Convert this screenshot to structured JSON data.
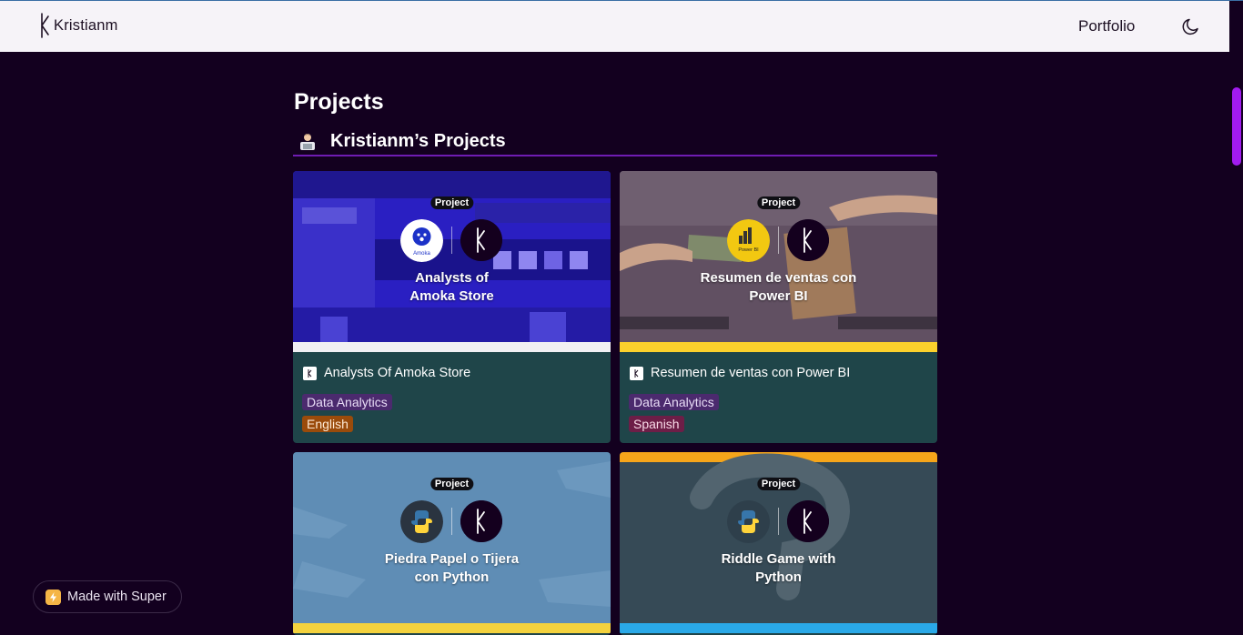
{
  "header": {
    "brand": "Kristianm",
    "nav_link": "Portfolio",
    "theme_toggle_icon": "moon-icon"
  },
  "page": {
    "title": "Projects",
    "section_emoji_icon": "technologist-emoji-icon",
    "section_title": "Kristianm’s Projects"
  },
  "cards": [
    {
      "badge": "Project",
      "cover_title_line1": "Analysts of",
      "cover_title_line2": "Amoka Store",
      "logo_text": "Amoka",
      "title": "Analysts Of Amoka Store",
      "tags": [
        "Data Analytics",
        "English"
      ]
    },
    {
      "badge": "Project",
      "cover_title_line1": "Resumen de ventas con",
      "cover_title_line2": "Power BI",
      "logo_text": "Power BI",
      "title": "Resumen de ventas con Power BI",
      "tags": [
        "Data Analytics",
        "Spanish"
      ]
    },
    {
      "badge": "Project",
      "cover_title_line1": "Piedra Papel o Tijera",
      "cover_title_line2": "con Python"
    },
    {
      "badge": "Project",
      "cover_title_line1": "Riddle Game with",
      "cover_title_line2": "Python"
    }
  ],
  "footer_badge": {
    "label": "Made with Super",
    "icon": "lightning-icon"
  },
  "colors": {
    "background": "#13001f",
    "navbar": "#f6f3f8",
    "accent": "#a21bf0",
    "card_body": "#1f4549"
  }
}
